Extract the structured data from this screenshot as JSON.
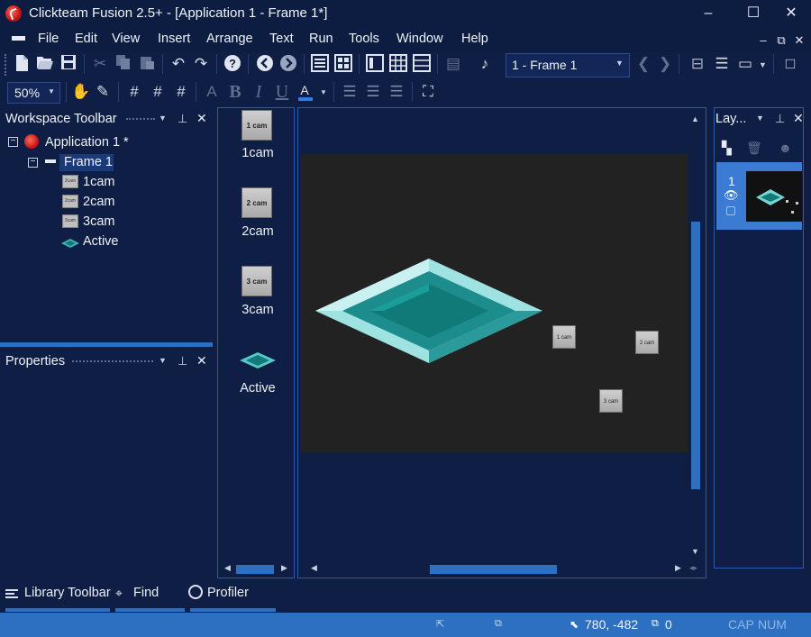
{
  "window": {
    "title": "Clickteam Fusion 2.5+ - [Application 1 - Frame 1*]",
    "minimize_icon": "minimize-icon",
    "maximize_icon": "maximize-icon",
    "close_icon": "close-icon"
  },
  "menu": {
    "items": [
      "File",
      "Edit",
      "View",
      "Insert",
      "Arrange",
      "Text",
      "Run",
      "Tools",
      "Window",
      "Help"
    ],
    "mdi_buttons": [
      "–",
      "⧉",
      "✕"
    ]
  },
  "toolbar": {
    "frame_select": "1 - Frame 1",
    "zoom": "50%"
  },
  "workspace": {
    "title": "Workspace Toolbar",
    "tree": {
      "application": "Application 1 *",
      "frame": "Frame 1",
      "objects": [
        "1cam",
        "2cam",
        "3cam",
        "Active"
      ]
    }
  },
  "properties": {
    "title": "Properties"
  },
  "library": {
    "objects": [
      {
        "label": "1cam",
        "icon_text": "1 cam"
      },
      {
        "label": "2cam",
        "icon_text": "2 cam"
      },
      {
        "label": "3cam",
        "icon_text": "3 cam"
      },
      {
        "label": "Active",
        "icon_text": ""
      }
    ]
  },
  "scene": {
    "background_color": "#222222",
    "camera_labels": [
      "1 cam",
      "2 cam",
      "3 cam"
    ]
  },
  "layers": {
    "title": "Lay...",
    "layer_number": "1"
  },
  "bottom_tabs": [
    "Library Toolbar",
    "Find",
    "Profiler"
  ],
  "status": {
    "coords": "780, -482",
    "count": "0",
    "cap": "CAP",
    "num": "NUM"
  },
  "colors": {
    "background": "#0f1e44",
    "accent": "#2d6fc0",
    "selection": "#3b7bd4",
    "diamond": "#1a8f8f"
  }
}
